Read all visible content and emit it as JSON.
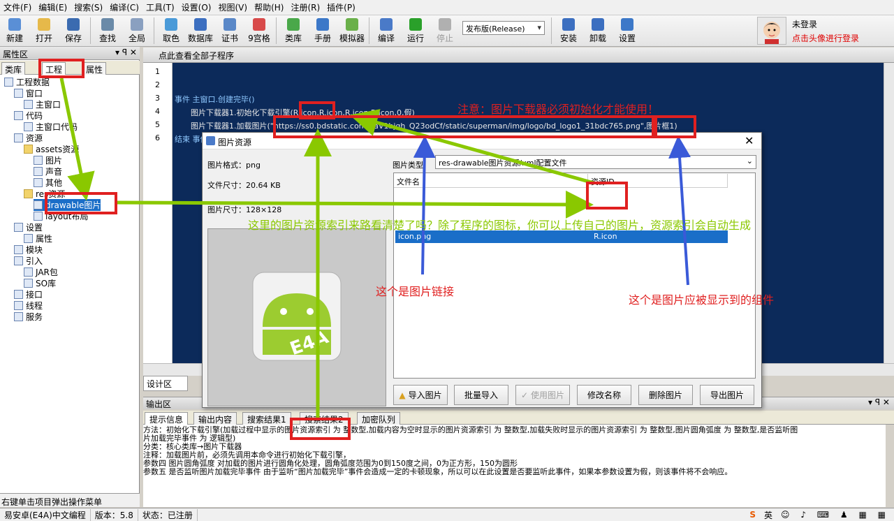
{
  "menu": [
    "文件(F)",
    "编辑(E)",
    "搜索(S)",
    "编译(C)",
    "工具(T)",
    "设置(O)",
    "视图(V)",
    "帮助(H)",
    "注册(R)",
    "插件(P)"
  ],
  "toolbar": {
    "buttons": [
      {
        "label": "新建",
        "icon": "new-file-icon",
        "color": "#5a8fd6"
      },
      {
        "label": "打开",
        "icon": "open-folder-icon",
        "color": "#e6b94a"
      },
      {
        "label": "保存",
        "icon": "save-icon",
        "color": "#3b6bb0"
      },
      {
        "label": "查找",
        "icon": "search-icon",
        "color": "#6a8aa8"
      },
      {
        "label": "全局",
        "icon": "global-search-icon",
        "color": "#8aa0c0"
      },
      {
        "label": "取色",
        "icon": "color-picker-icon",
        "color": "#4a9ad8"
      },
      {
        "label": "数据库",
        "icon": "database-icon",
        "color": "#3c6fc0"
      },
      {
        "label": "证书",
        "icon": "certificate-icon",
        "color": "#5a88c8"
      },
      {
        "label": "9宫格",
        "icon": "nine-grid-icon",
        "color": "#d84a4a"
      },
      {
        "label": "类库",
        "icon": "library-icon",
        "color": "#4aa84a"
      },
      {
        "label": "手册",
        "icon": "manual-icon",
        "color": "#3c78c8"
      },
      {
        "label": "模拟器",
        "icon": "emulator-icon",
        "color": "#6ab04a"
      },
      {
        "label": "编译",
        "icon": "compile-icon",
        "color": "#4a7ac8"
      },
      {
        "label": "运行",
        "icon": "run-icon",
        "color": "#2aa02a"
      },
      {
        "label": "停止",
        "icon": "stop-icon",
        "color": "#b0b0b0"
      }
    ],
    "release_select": "发布版(Release)",
    "right_buttons": [
      {
        "label": "安装",
        "icon": "install-icon",
        "color": "#3c6fc0"
      },
      {
        "label": "卸载",
        "icon": "uninstall-icon",
        "color": "#3c6fc0"
      },
      {
        "label": "设置",
        "icon": "settings-icon",
        "color": "#3c78c8"
      }
    ]
  },
  "user": {
    "status": "未登录",
    "hint": "点击头像进行登录"
  },
  "left_panel": {
    "title": "属性区",
    "tabs": [
      "类库",
      "工程",
      "属性"
    ],
    "tree": [
      {
        "label": "工程数据",
        "depth": 0
      },
      {
        "label": "窗口",
        "depth": 1
      },
      {
        "label": "主窗口",
        "depth": 2
      },
      {
        "label": "代码",
        "depth": 1
      },
      {
        "label": "主窗口代码",
        "depth": 2
      },
      {
        "label": "资源",
        "depth": 1
      },
      {
        "label": "assets资源",
        "depth": 2
      },
      {
        "label": "图片",
        "depth": 3
      },
      {
        "label": "声音",
        "depth": 3
      },
      {
        "label": "其他",
        "depth": 3
      },
      {
        "label": "res资源",
        "depth": 2
      },
      {
        "label": "drawable图片",
        "depth": 3
      },
      {
        "label": "layout布局",
        "depth": 3
      },
      {
        "label": "设置",
        "depth": 1
      },
      {
        "label": "属性",
        "depth": 2
      },
      {
        "label": "模块",
        "depth": 1
      },
      {
        "label": "引入",
        "depth": 1
      },
      {
        "label": "JAR包",
        "depth": 2
      },
      {
        "label": "SO库",
        "depth": 2
      },
      {
        "label": "接口",
        "depth": 1
      },
      {
        "label": "线程",
        "depth": 1
      },
      {
        "label": "服务",
        "depth": 1
      }
    ],
    "footer": "右键单击项目弹出操作菜单"
  },
  "editor": {
    "header": "点此查看全部子程序",
    "line_numbers": [
      "1",
      "2",
      "3",
      "4",
      "5",
      "6"
    ],
    "lines": [
      "",
      "",
      "事件 主窗口.创建完毕()",
      "图片下载器1.初始化下载引擎(R.icon,R.icon,R.icon,R.icon,0,假)",
      "图片下载器1.加载图片(\"https://ss0.bdstatic.com/5aV1bjqh_Q23odCf/static/superman/img/logo/bd_logo1_31bdc765.png\",图片框1)",
      "结束 事件"
    ],
    "bottom_tab": "设计区"
  },
  "dialog": {
    "title": "图片资源",
    "format_label": "图片格式：png",
    "file_size": "文件尺寸：20.64 KB",
    "image_size": "图片尺寸：128×128",
    "type_label": "图片类型",
    "type_value": "res-drawable图片资源/xml配置文件",
    "columns": [
      "文件名",
      "资源ID"
    ],
    "rows": [
      {
        "file": "icon.png",
        "id": "R.icon"
      }
    ],
    "preview_text": "E4A",
    "buttons": [
      "导入图片",
      "批量导入",
      "使用图片",
      "修改名称",
      "删除图片",
      "导出图片"
    ]
  },
  "output": {
    "title": "输出区",
    "tabs": [
      "提示信息",
      "输出内容",
      "搜索结果1",
      "搜索结果2",
      "加密队列"
    ],
    "lines": [
      "方法：初始化下载引擎(加载过程中显示的图片资源索引 为 整数型,加载内容为空时显示的图片资源索引 为 整数型,加载失败时显示的图片资源索引 为 整数型,图片圆角弧度 为 整数型,是否监听图",
      "片加载完毕事件 为 逻辑型)",
      "分类：核心类库→图片下载器",
      "注释：加载图片前，必须先调用本命令进行初始化下载引擎，",
      "参数四 图片圆角弧度 对加载的图片进行圆角化处理，圆角弧度范围为0到150度之间，0为正方形，150为圆形",
      "参数五 是否监听图片加载完毕事件 由于监听“图片加载完毕”事件会造成一定的卡顿现象，所以可以在此设置是否要监听此事件，如果本参数设置为假，则该事件将不会响应。"
    ]
  },
  "status": {
    "app": "易安卓(E4A)中文编程",
    "version": "版本：5.8",
    "state": "状态：已注册",
    "ime": "英"
  },
  "annotations": {
    "note1": "注意：图片下载器必须初始化才能使用！",
    "note2": "这里的图片资源索引来路看清楚了吗？除了程序的图标，你可以上传自己的图片，资源索引会自动生成",
    "note3": "这个是图片链接",
    "note4": "这个是图片应被显示到的组件",
    "highlight": "图片资源索引",
    "red": "#e02020",
    "green": "#8ac800",
    "blue": "#3a5ad8"
  }
}
